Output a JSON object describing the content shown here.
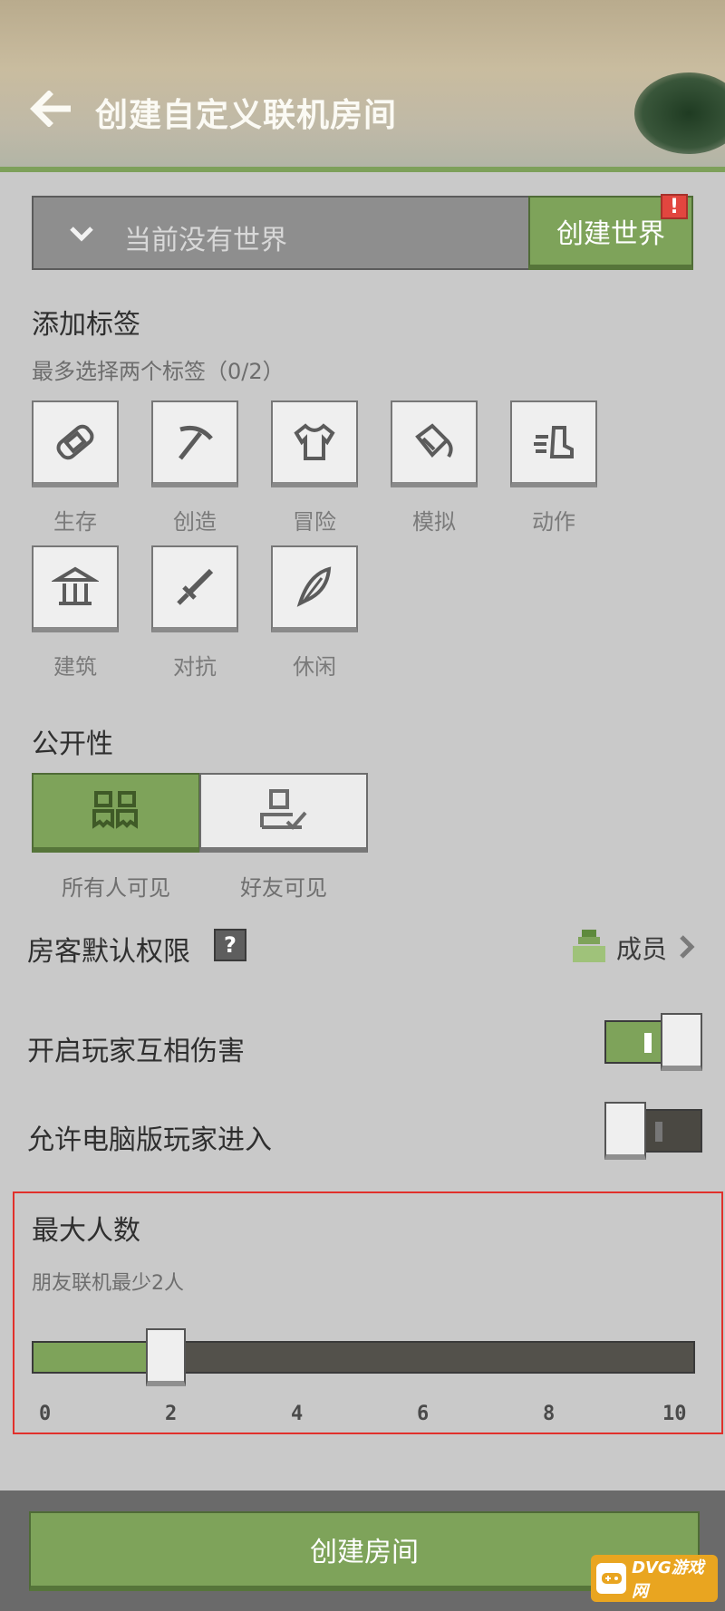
{
  "header": {
    "title": "创建自定义联机房间"
  },
  "world": {
    "placeholder": "当前没有世界",
    "create_label": "创建世界",
    "alert": "!"
  },
  "tags": {
    "title": "添加标签",
    "hint": "最多选择两个标签（0/2）",
    "items": [
      {
        "label": "生存",
        "icon": "bandage-icon"
      },
      {
        "label": "创造",
        "icon": "pickaxe-icon"
      },
      {
        "label": "冒险",
        "icon": "shirt-icon"
      },
      {
        "label": "模拟",
        "icon": "bucket-icon"
      },
      {
        "label": "动作",
        "icon": "boot-icon"
      },
      {
        "label": "建筑",
        "icon": "building-icon"
      },
      {
        "label": "对抗",
        "icon": "sword-icon"
      },
      {
        "label": "休闲",
        "icon": "feather-icon"
      }
    ]
  },
  "visibility": {
    "title": "公开性",
    "options": [
      {
        "label": "所有人可见",
        "selected": true
      },
      {
        "label": "好友可见",
        "selected": false
      }
    ]
  },
  "permissions": {
    "label": "房客默认权限",
    "help": "?",
    "value": "成员"
  },
  "pvp": {
    "label": "开启玩家互相伤害",
    "on": true
  },
  "pc_join": {
    "label": "允许电脑版玩家进入",
    "on": false
  },
  "max_players": {
    "title": "最大人数",
    "hint": "朋友联机最少2人",
    "value": 2,
    "min": 0,
    "max": 10,
    "ticks": [
      "0",
      "2",
      "4",
      "6",
      "8",
      "10"
    ]
  },
  "footer": {
    "create_room": "创建房间"
  },
  "watermark": {
    "text": "DVG游戏网"
  },
  "colors": {
    "accent": "#7ea35a",
    "alert": "#e2463f",
    "highlight_box": "#e1302b"
  }
}
